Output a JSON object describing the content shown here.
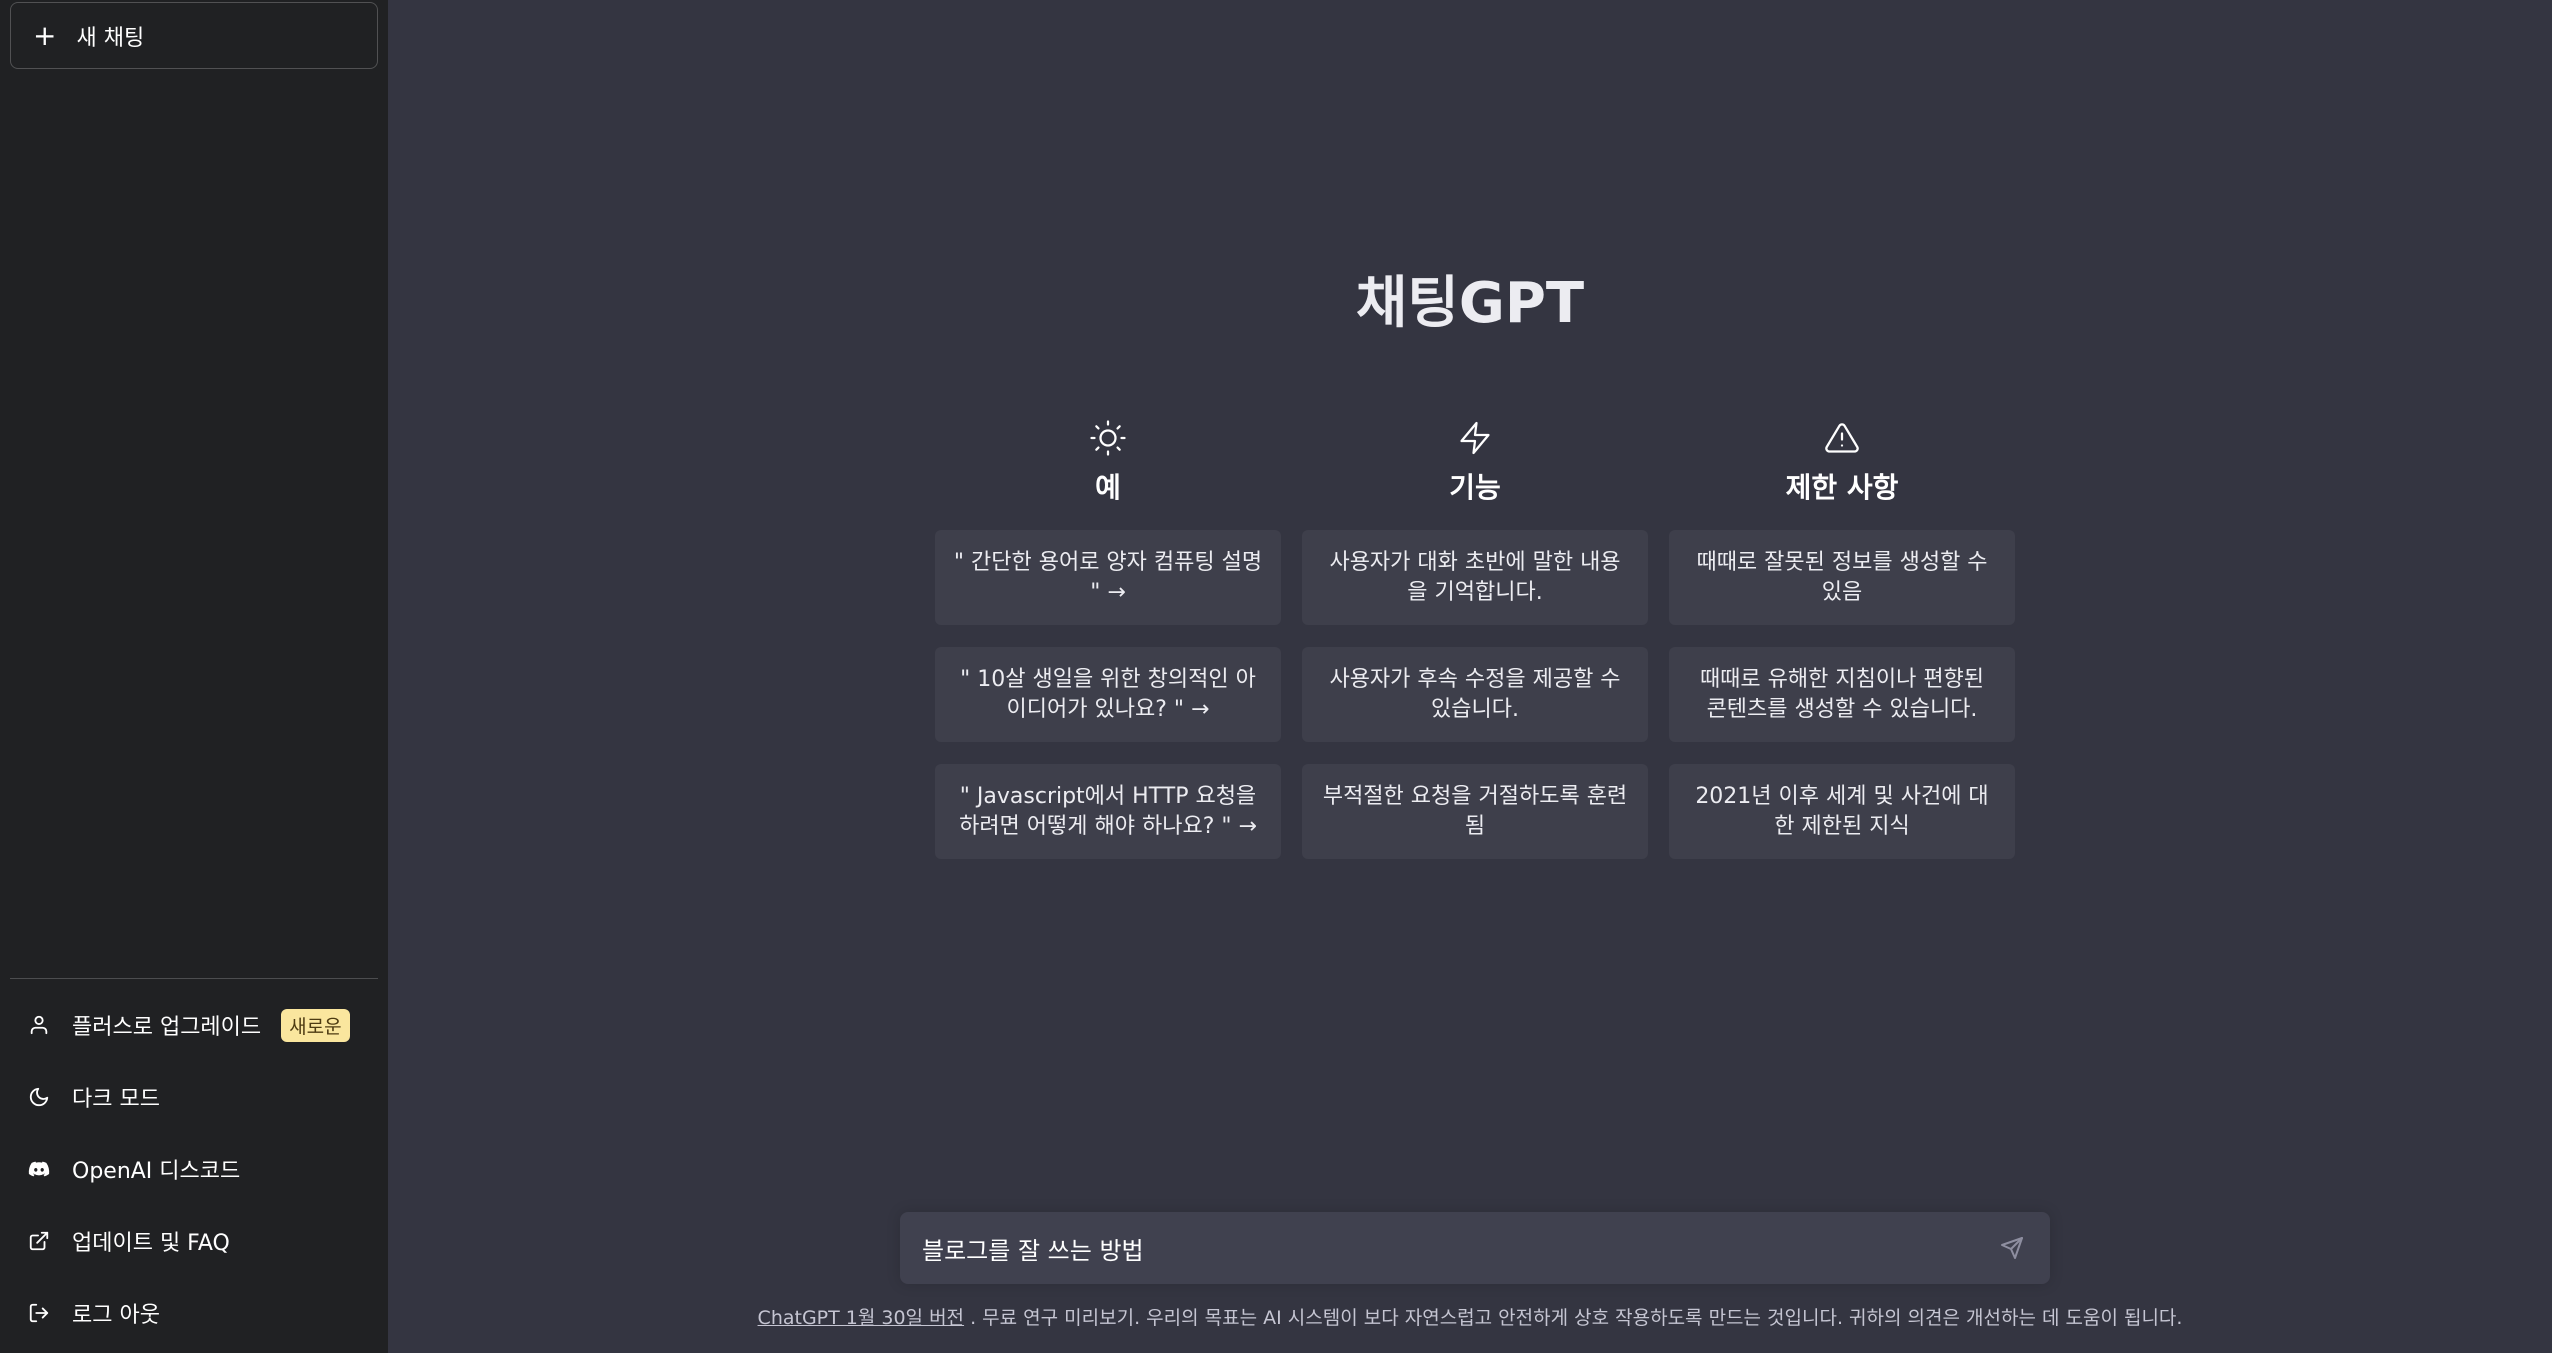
{
  "sidebar": {
    "new_chat_label": "새 채팅",
    "items": [
      {
        "label": "플러스로 업그레이드",
        "icon": "user-icon",
        "badge": "새로운"
      },
      {
        "label": "다크 모드",
        "icon": "moon-icon"
      },
      {
        "label": "OpenAI 디스코드",
        "icon": "discord-icon"
      },
      {
        "label": "업데이트 및 FAQ",
        "icon": "external-link-icon"
      },
      {
        "label": "로그 아웃",
        "icon": "logout-icon"
      }
    ]
  },
  "main": {
    "title": "채팅GPT",
    "columns": [
      {
        "icon": "sun-icon",
        "title": "예",
        "cards": [
          "\" 간단한 용어로 양자 컴퓨팅 설명 \" →",
          "\" 10살 생일을 위한 창의적인 아이디어가 있나요? \" →",
          "\" Javascript에서 HTTP 요청을 하려면 어떻게 해야 하나요? \" →"
        ]
      },
      {
        "icon": "lightning-icon",
        "title": "기능",
        "cards": [
          "사용자가 대화 초반에 말한 내용을 기억합니다.",
          "사용자가 후속 수정을 제공할 수 있습니다.",
          "부적절한 요청을 거절하도록 훈련됨"
        ]
      },
      {
        "icon": "warning-icon",
        "title": "제한 사항",
        "cards": [
          "때때로 잘못된 정보를 생성할 수 있음",
          "때때로 유해한 지침이나 편향된 콘텐츠를 생성할 수 있습니다.",
          "2021년 이후 세계 및 사건에 대한 제한된 지식"
        ]
      }
    ],
    "input_value": "블로그를 잘 쓰는 방법",
    "footer_link": "ChatGPT 1월 30일 버전",
    "footer_text": ". 무료 연구 미리보기. 우리의 목표는 AI 시스템이 보다 자연스럽고 안전하게 상호 작용하도록 만드는 것입니다. 귀하의 의견은 개선하는 데 도움이 됩니다."
  },
  "colors": {
    "sidebar_bg": "#202123",
    "main_bg": "#343541",
    "card_bg": "#3e3f4b",
    "input_bg": "#40414f",
    "badge_bg": "#fae69e"
  }
}
